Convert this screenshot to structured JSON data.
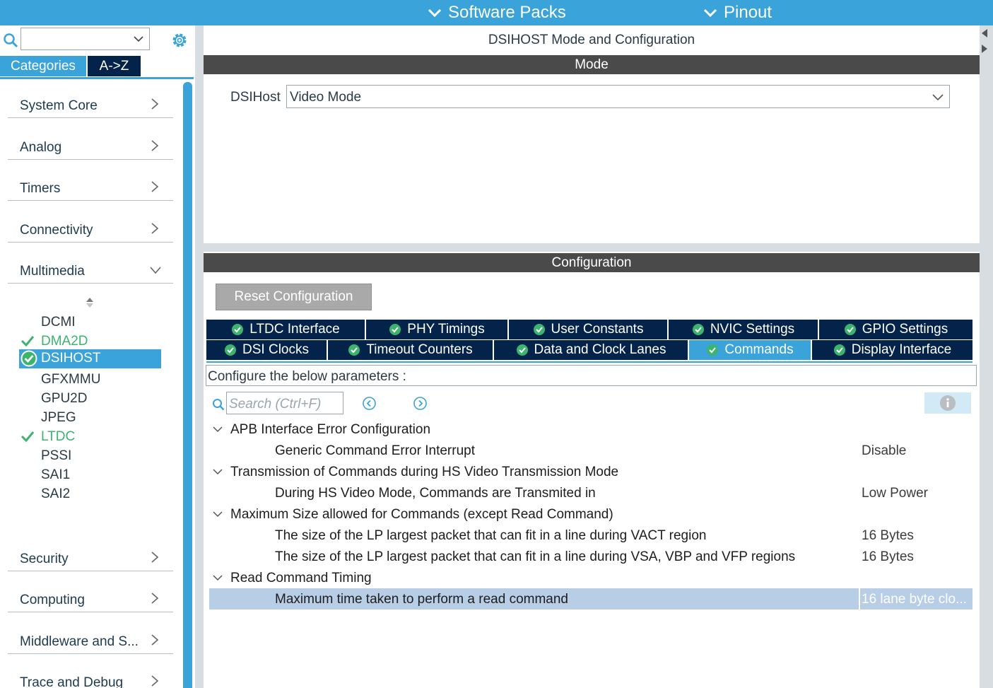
{
  "topbar": {
    "software_packs": "Software Packs",
    "pinout": "Pinout"
  },
  "left": {
    "search_value": "",
    "tabs": {
      "categories": "Categories",
      "az": "A->Z"
    },
    "categories": [
      {
        "label": "System Core"
      },
      {
        "label": "Analog"
      },
      {
        "label": "Timers"
      },
      {
        "label": "Connectivity"
      },
      {
        "label": "Multimedia"
      },
      {
        "label": "Security"
      },
      {
        "label": "Computing"
      },
      {
        "label": "Middleware and S..."
      },
      {
        "label": "Trace and Debug"
      }
    ],
    "multimedia_items": [
      {
        "label": "DCMI",
        "status": "none"
      },
      {
        "label": "DMA2D",
        "status": "enabled"
      },
      {
        "label": "DSIHOST",
        "status": "selected"
      },
      {
        "label": "GFXMMU",
        "status": "none"
      },
      {
        "label": "GPU2D",
        "status": "none"
      },
      {
        "label": "JPEG",
        "status": "none"
      },
      {
        "label": "LTDC",
        "status": "enabled"
      },
      {
        "label": "PSSI",
        "status": "none"
      },
      {
        "label": "SAI1",
        "status": "none"
      },
      {
        "label": "SAI2",
        "status": "none"
      }
    ]
  },
  "mode": {
    "title": "DSIHOST Mode and Configuration",
    "section": "Mode",
    "dsihost_label": "DSIHost",
    "dsihost_value": "Video Mode"
  },
  "config": {
    "section": "Configuration",
    "reset_label": "Reset Configuration",
    "tabs_row1": [
      "LTDC Interface",
      "PHY Timings",
      "User Constants",
      "NVIC Settings",
      "GPIO Settings"
    ],
    "tabs_row2": [
      "DSI Clocks",
      "Timeout Counters",
      "Data and Clock Lanes",
      "Commands",
      "Display Interface"
    ],
    "active_tab": "Commands",
    "params_label": "Configure the below parameters :",
    "search_placeholder": "Search (Ctrl+F)",
    "groups": [
      {
        "title": "APB Interface Error Configuration",
        "params": [
          {
            "name": "Generic Command Error Interrupt",
            "value": "Disable"
          }
        ]
      },
      {
        "title": "Transmission of Commands during HS Video Transmission Mode",
        "params": [
          {
            "name": "During HS Video Mode, Commands are Transmited in",
            "value": "Low Power"
          }
        ]
      },
      {
        "title": "Maximum Size allowed for Commands (except Read Command)",
        "params": [
          {
            "name": "The size of the LP largest packet that can fit in a line during VACT region",
            "value": "16 Bytes"
          },
          {
            "name": "The size of the LP largest packet that can fit in a line during VSA, VBP and VFP regions",
            "value": "16 Bytes"
          }
        ]
      },
      {
        "title": "Read Command Timing",
        "params": [
          {
            "name": "Maximum time taken to perform a read command",
            "value": "16 lane byte clo..."
          }
        ]
      }
    ]
  },
  "colors": {
    "accent": "#3aa3d9",
    "navy": "#03234b",
    "bar": "#4a4a4a",
    "green": "#3cb46e",
    "selected_row": "#b8cde6"
  }
}
